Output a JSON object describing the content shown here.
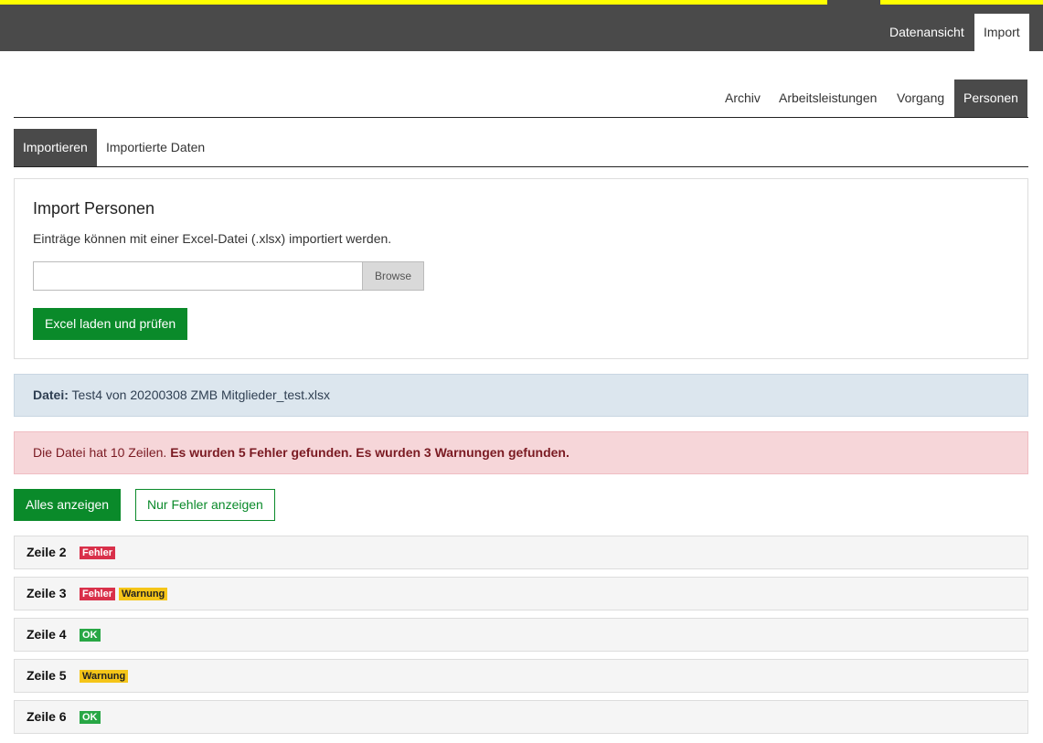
{
  "topnav": {
    "items": [
      {
        "label": "Datenansicht",
        "active": false
      },
      {
        "label": "Import",
        "active": true
      }
    ]
  },
  "section_tabs": [
    {
      "label": "Archiv",
      "active": false
    },
    {
      "label": "Arbeitsleistungen",
      "active": false
    },
    {
      "label": "Vorgang",
      "active": false
    },
    {
      "label": "Personen",
      "active": true
    }
  ],
  "sub_tabs": [
    {
      "label": "Importieren",
      "active": true
    },
    {
      "label": "Importierte Daten",
      "active": false
    }
  ],
  "import_panel": {
    "title": "Import Personen",
    "description": "Einträge können mit einer Excel-Datei (.xlsx) importiert werden.",
    "file_value": "",
    "browse_label": "Browse",
    "load_button": "Excel laden und prüfen"
  },
  "file_info": {
    "label": "Datei:",
    "filename": "Test4 von 20200308 ZMB Mitglieder_test.xlsx"
  },
  "summary": {
    "prefix": "Die Datei hat 10 Zeilen.",
    "errors": "Es wurden 5 Fehler gefunden.",
    "warnings": "Es wurden 3 Warnungen gefunden."
  },
  "filters": {
    "all_label": "Alles anzeigen",
    "errors_only_label": "Nur Fehler anzeigen"
  },
  "rows": [
    {
      "label": "Zeile 2",
      "badges": [
        {
          "type": "error",
          "text": "Fehler"
        }
      ]
    },
    {
      "label": "Zeile 3",
      "badges": [
        {
          "type": "error",
          "text": "Fehler"
        },
        {
          "type": "warn",
          "text": "Warnung"
        }
      ]
    },
    {
      "label": "Zeile 4",
      "badges": [
        {
          "type": "ok",
          "text": "OK"
        }
      ]
    },
    {
      "label": "Zeile 5",
      "badges": [
        {
          "type": "warn",
          "text": "Warnung"
        }
      ]
    },
    {
      "label": "Zeile 6",
      "badges": [
        {
          "type": "ok",
          "text": "OK"
        }
      ]
    }
  ],
  "colors": {
    "nav_bg": "#4a4a4a",
    "accent_yellow": "#ffff00",
    "primary_green": "#0a8a2a",
    "error": "#d9304a",
    "warning": "#f5c518",
    "ok": "#28a745"
  }
}
